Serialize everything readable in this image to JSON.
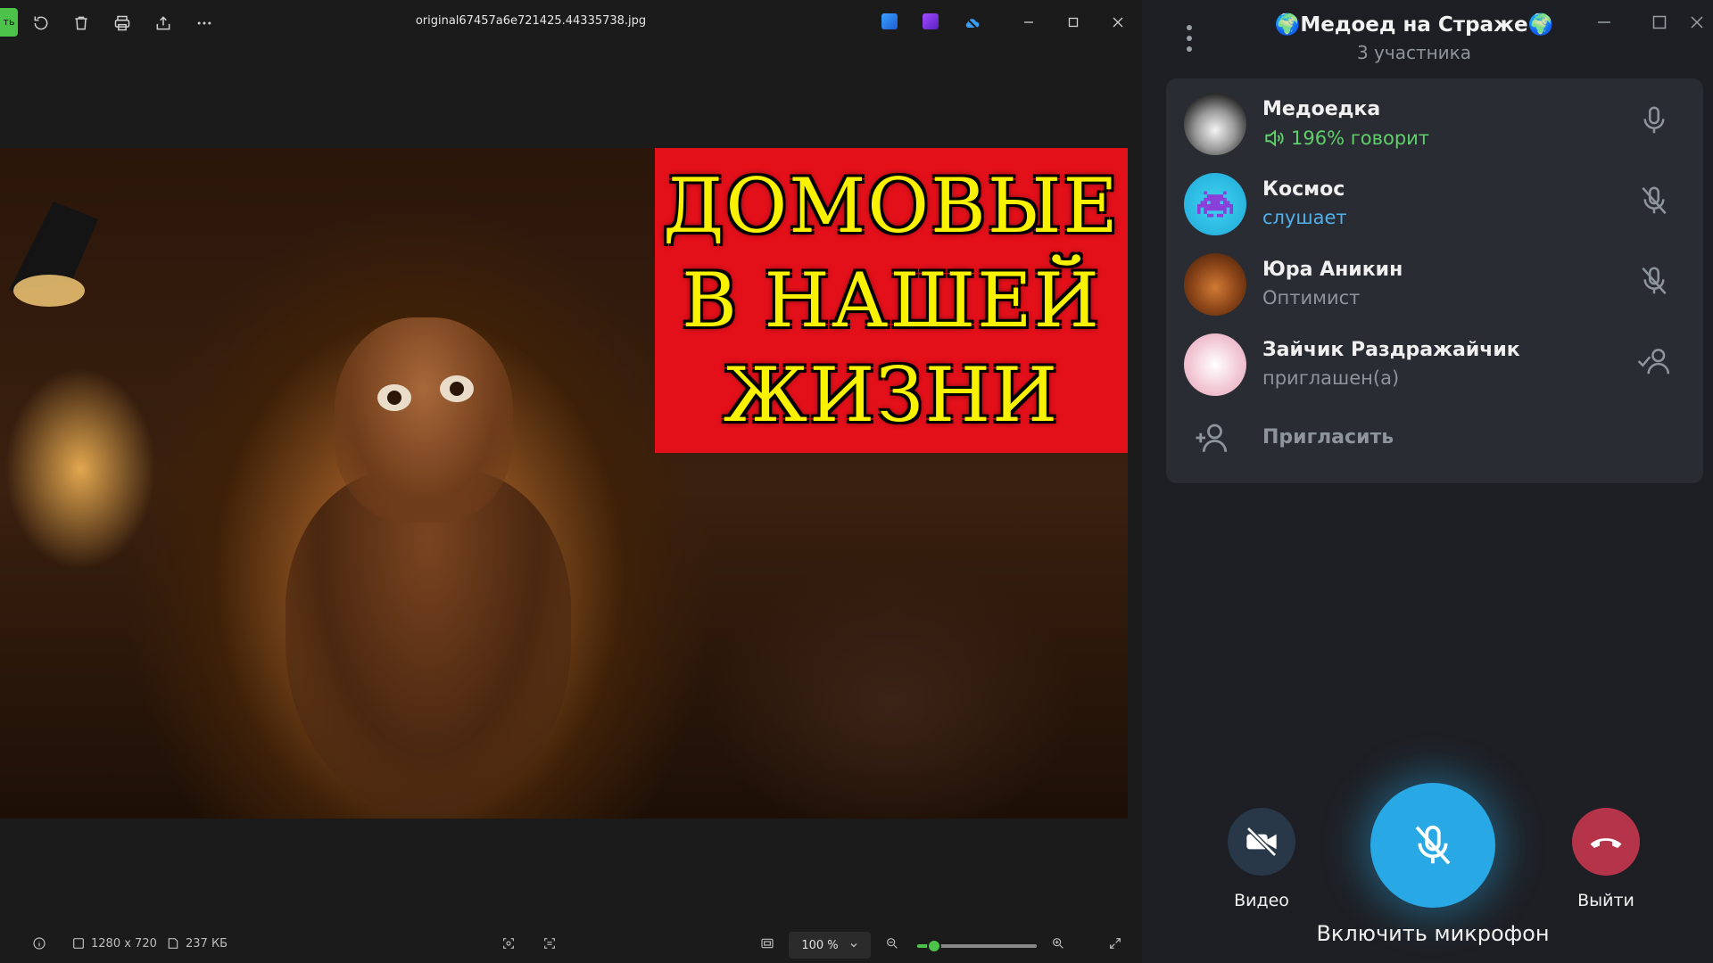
{
  "viewer": {
    "green_tab_label": "ть",
    "filename": "original67457a6e721425.44335738.jpg",
    "photo_title_lines": [
      "ДОМОВЫЕ",
      "В НАШЕЙ",
      "ЖИЗНИ"
    ],
    "status": {
      "dimensions": "1280 x 720",
      "file_size": "237 КБ"
    },
    "zoom": {
      "label": "100 %",
      "fraction": 0.14
    }
  },
  "call": {
    "title": "🌍Медоед на Страже🌍",
    "subtitle": "3 участника",
    "participants": [
      {
        "name": "Медоедка",
        "status": "196% говорит",
        "state": "speaking"
      },
      {
        "name": "Космос",
        "status": "слушает",
        "state": "listening"
      },
      {
        "name": "Юра Аникин",
        "status": "Оптимист",
        "state": "muted"
      },
      {
        "name": "Зайчик Раздражайчик",
        "status": "приглашен(а)",
        "state": "invited"
      }
    ],
    "invite_label": "Пригласить",
    "video_label": "Видео",
    "mic_label": "Включить микрофон",
    "leave_label": "Выйти"
  },
  "colors": {
    "speaking": "#5fd06a",
    "listening": "#4fb0ea",
    "mic_button": "#29a8e6",
    "leave_button": "#b5344a",
    "title_box": "#e3101a",
    "title_text": "#f8f200"
  },
  "icons": [
    "rotate-icon",
    "trash-icon",
    "print-icon",
    "share-icon",
    "more-icon",
    "edit-icon",
    "image-icon",
    "cloud-off-icon",
    "minimize-icon",
    "maximize-icon",
    "close-icon",
    "info-icon",
    "dimensions-icon",
    "filesize-icon",
    "face-detect-icon",
    "scan-icon",
    "fit-screen-icon",
    "zoom-out-icon",
    "zoom-in-icon",
    "fullscreen-icon",
    "menu-dots-icon",
    "microphone-icon",
    "microphone-off-icon",
    "speaker-icon",
    "user-check-icon",
    "add-user-icon",
    "video-off-icon",
    "phone-hangup-icon"
  ]
}
